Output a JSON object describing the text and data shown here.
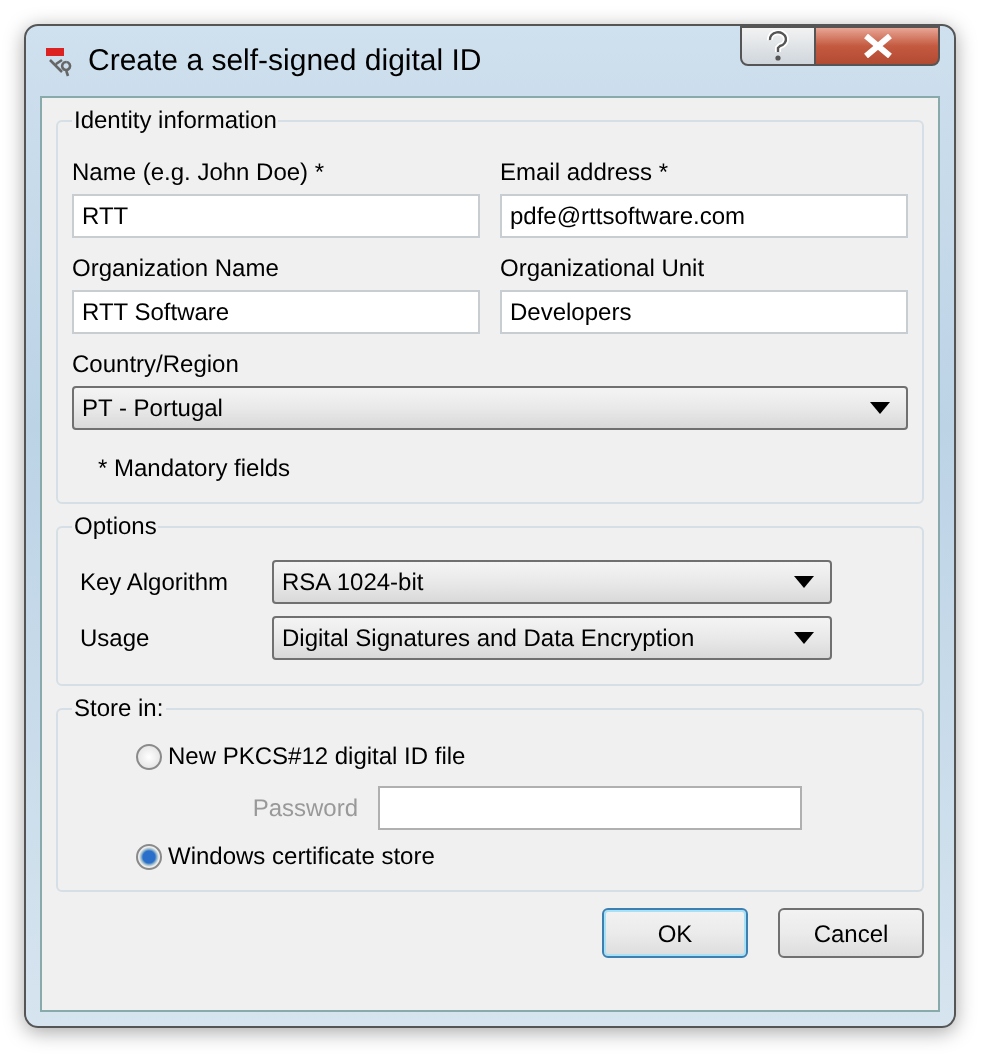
{
  "window": {
    "title": "Create a self-signed digital ID"
  },
  "identity": {
    "title": "Identity information",
    "fields": [
      {
        "label": "Name (e.g. John Doe) *",
        "value": "RTT"
      },
      {
        "label": "Email address *",
        "value": "pdfe@rttsoftware.com"
      },
      {
        "label": "Organization Name",
        "value": "RTT Software"
      },
      {
        "label": "Organizational Unit",
        "value": "Developers"
      }
    ],
    "country": {
      "label": "Country/Region",
      "value": "PT - Portugal"
    },
    "note": "* Mandatory fields"
  },
  "options": {
    "title": "Options",
    "rows": [
      {
        "label": "Key Algorithm",
        "value": "RSA 1024-bit"
      },
      {
        "label": "Usage",
        "value": "Digital Signatures and Data Encryption"
      }
    ]
  },
  "store": {
    "title": "Store in:",
    "choices": [
      {
        "label": "New PKCS#12 digital ID file",
        "selected": false
      },
      {
        "label": "Windows certificate store",
        "selected": true
      }
    ],
    "password": {
      "label": "Password",
      "disabled": true
    }
  },
  "buttons": [
    {
      "label": "OK",
      "default": true
    },
    {
      "label": "Cancel",
      "default": false
    }
  ]
}
